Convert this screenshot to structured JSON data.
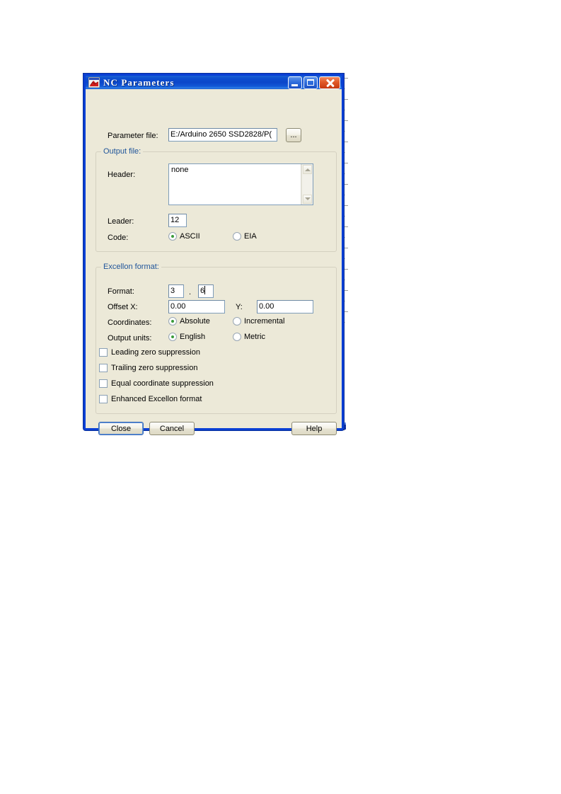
{
  "window": {
    "title": "NC Parameters",
    "icon": "app-icon",
    "buttons": {
      "minimize": "minimize",
      "maximize": "maximize",
      "close": "close"
    }
  },
  "parameter_file": {
    "label": "Parameter file:",
    "value": "E:/Arduino 2650 SSD2828/P(",
    "browse_label": "..."
  },
  "output_file": {
    "legend": "Output file:",
    "header": {
      "label": "Header:",
      "value": "none"
    },
    "leader": {
      "label": "Leader:",
      "value": "12"
    },
    "code": {
      "label": "Code:",
      "selected": "ASCII",
      "options": [
        "ASCII",
        "EIA"
      ]
    }
  },
  "excellon_format": {
    "legend": "Excellon format:",
    "format": {
      "label": "Format:",
      "integer": "3",
      "separator": ".",
      "decimal": "6"
    },
    "offset": {
      "x_label": "Offset X:",
      "x_value": "0.00",
      "y_label": "Y:",
      "y_value": "0.00"
    },
    "coordinates": {
      "label": "Coordinates:",
      "selected": "Absolute",
      "options": [
        "Absolute",
        "Incremental"
      ]
    },
    "output_units": {
      "label": "Output units:",
      "selected": "English",
      "options": [
        "English",
        "Metric"
      ]
    },
    "checkboxes": [
      {
        "label": "Leading zero suppression",
        "checked": false
      },
      {
        "label": "Trailing zero suppression",
        "checked": false
      },
      {
        "label": "Equal coordinate suppression",
        "checked": false
      },
      {
        "label": "Enhanced Excellon format",
        "checked": false
      }
    ]
  },
  "footer": {
    "close_label": "Close",
    "cancel_label": "Cancel",
    "help_label": "Help"
  },
  "colors": {
    "dialog_face": "#ECE9D8",
    "titlebar_blue": "#0B46C9",
    "group_legend": "#20559A",
    "field_border": "#7F9DB9",
    "radio_dot_green": "#3A9B3A",
    "close_button_red": "#C7380F"
  }
}
